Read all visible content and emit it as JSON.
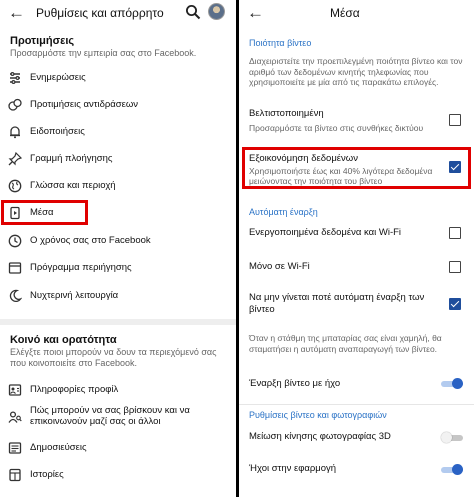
{
  "left": {
    "header": {
      "back_icon": "back-arrow-icon",
      "title": "Ρυθμίσεις και απόρρητο"
    },
    "preferences": {
      "title": "Προτιμήσεις",
      "description": "Προσαρμόστε την εμπειρία σας στο Facebook.",
      "items": [
        {
          "label": "Ενημερώσεις",
          "icon": "feed-icon"
        },
        {
          "label": "Προτιμήσεις αντιδράσεων",
          "icon": "reactions-icon"
        },
        {
          "label": "Ειδοποιήσεις",
          "icon": "bell-icon"
        },
        {
          "label": "Γραμμή πλοήγησης",
          "icon": "pin-icon"
        },
        {
          "label": "Γλώσσα και περιοχή",
          "icon": "globe-icon"
        },
        {
          "label": "Μέσα",
          "icon": "media-icon"
        },
        {
          "label": "Ο χρόνος σας στο Facebook",
          "icon": "clock-icon"
        },
        {
          "label": "Πρόγραμμα περιήγησης",
          "icon": "browser-icon"
        },
        {
          "label": "Νυχτερινή λειτουργία",
          "icon": "moon-icon"
        }
      ]
    },
    "audience": {
      "title": "Κοινό και ορατότητα",
      "description": "Ελέγξτε ποιοι μπορούν να δουν τα περιεχόμενό σας που κοινοποιείτε στο Facebook.",
      "items": [
        {
          "label": "Πληροφορίες προφίλ",
          "icon": "profile-info-icon"
        },
        {
          "label": "Πώς μπορούν να σας βρίσκουν και να επικοινωνούν μαζί σας οι άλλοι",
          "icon": "find-people-icon"
        },
        {
          "label": "Δημοσιεύσεις",
          "icon": "posts-icon"
        },
        {
          "label": "Ιστορίες",
          "icon": "stories-icon"
        }
      ]
    }
  },
  "right": {
    "header": {
      "back_icon": "back-arrow-icon",
      "title": "Μέσα"
    },
    "video_quality": {
      "title": "Ποιότητα βίντεο",
      "description": "Διαχειριστείτε την προεπιλεγμένη ποιότητα βίντεο και τον αριθμό των δεδομένων κινητής τηλεφωνίας που χρησιμοποιείτε με μία από τις παρακάτω επιλογές.",
      "options": [
        {
          "title": "Βελτιστοποιημένη",
          "description": "Προσαρμόστε τα βίντεο στις συνθήκες δικτύου",
          "checked": false
        },
        {
          "title": "Εξοικονόμηση δεδομένων",
          "description": "Χρησιμοποιήστε έως και 40% λιγότερα δεδομένα μειώνοντας την ποιότητα του βίντεο",
          "checked": true
        }
      ]
    },
    "autoplay": {
      "title": "Αυτόματη έναρξη",
      "options": [
        {
          "title": "Ενεργοποιημένα δεδομένα και Wi-Fi",
          "checked": false
        },
        {
          "title": "Μόνο σε Wi-Fi",
          "checked": false
        },
        {
          "title": "Να μην γίνεται ποτέ αυτόματη έναρξη των βίντεο",
          "checked": true
        }
      ],
      "note": "Όταν η στάθμη της μπαταρίας σας είναι χαμηλή, θα σταματήσει η αυτόματη αναπαραγωγή των βίντεο."
    },
    "sound": {
      "title": "Έναρξη βίντεο με ήχο",
      "on": true
    },
    "video_photo": {
      "title": "Ρυθμίσεις βίντεο και φωτογραφιών",
      "options": [
        {
          "title": "Μείωση κίνησης φωτογραφίας 3D",
          "on": false
        },
        {
          "title": "Ήχοι στην εφαρμογή",
          "on": true
        }
      ]
    }
  }
}
